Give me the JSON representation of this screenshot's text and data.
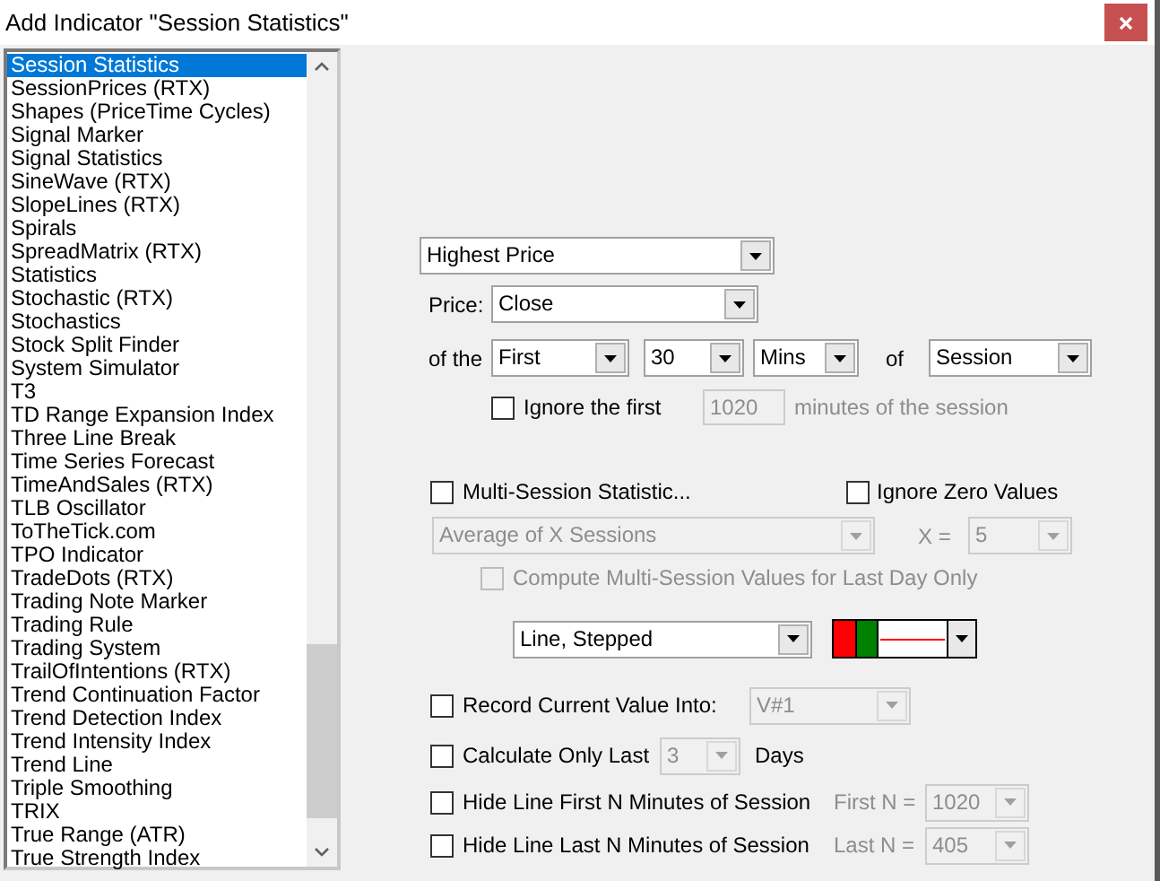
{
  "window": {
    "title": "Add Indicator \"Session Statistics\""
  },
  "indicator_list": {
    "items": [
      {
        "label": "Session Statistics",
        "selected": true
      },
      {
        "label": "SessionPrices (RTX)",
        "selected": false
      },
      {
        "label": "Shapes (PriceTime Cycles)",
        "selected": false
      },
      {
        "label": "Signal Marker",
        "selected": false
      },
      {
        "label": "Signal Statistics",
        "selected": false
      },
      {
        "label": "SineWave (RTX)",
        "selected": false
      },
      {
        "label": "SlopeLines (RTX)",
        "selected": false
      },
      {
        "label": "Spirals",
        "selected": false
      },
      {
        "label": "SpreadMatrix (RTX)",
        "selected": false
      },
      {
        "label": "Statistics",
        "selected": false
      },
      {
        "label": "Stochastic (RTX)",
        "selected": false
      },
      {
        "label": "Stochastics",
        "selected": false
      },
      {
        "label": "Stock Split Finder",
        "selected": false
      },
      {
        "label": "System Simulator",
        "selected": false
      },
      {
        "label": "T3",
        "selected": false
      },
      {
        "label": "TD Range Expansion Index",
        "selected": false
      },
      {
        "label": "Three Line Break",
        "selected": false
      },
      {
        "label": "Time Series Forecast",
        "selected": false
      },
      {
        "label": "TimeAndSales (RTX)",
        "selected": false
      },
      {
        "label": "TLB Oscillator",
        "selected": false
      },
      {
        "label": "ToTheTick.com",
        "selected": false
      },
      {
        "label": "TPO Indicator",
        "selected": false
      },
      {
        "label": "TradeDots (RTX)",
        "selected": false
      },
      {
        "label": "Trading Note Marker",
        "selected": false
      },
      {
        "label": "Trading Rule",
        "selected": false
      },
      {
        "label": "Trading System",
        "selected": false
      },
      {
        "label": "TrailOfIntentions (RTX)",
        "selected": false
      },
      {
        "label": "Trend Continuation Factor",
        "selected": false
      },
      {
        "label": "Trend Detection Index",
        "selected": false
      },
      {
        "label": "Trend Intensity Index",
        "selected": false
      },
      {
        "label": "Trend Line",
        "selected": false
      },
      {
        "label": "Triple Smoothing",
        "selected": false
      },
      {
        "label": "TRIX",
        "selected": false
      },
      {
        "label": "True Range (ATR)",
        "selected": false
      },
      {
        "label": "True Strength Index",
        "selected": false
      }
    ]
  },
  "statistic": {
    "value": "Highest Price",
    "disabled": false
  },
  "price": {
    "label": "Price:",
    "combo": {
      "value": "Close",
      "disabled": false
    }
  },
  "range": {
    "label": "of the",
    "position": {
      "value": "First",
      "disabled": false
    },
    "count": {
      "value": "30",
      "disabled": false
    },
    "unit": {
      "value": "Mins",
      "disabled": false
    },
    "of_label": "of",
    "period": {
      "value": "Session",
      "disabled": false
    }
  },
  "ignore_first": {
    "checked": false,
    "label": "Ignore the first",
    "value": "1020",
    "disabled": true,
    "suffix": "minutes of the session"
  },
  "multi_session": {
    "checked": false,
    "label": "Multi-Session Statistic...",
    "method": {
      "value": "Average of X Sessions",
      "disabled": true
    },
    "x_label": "X =",
    "x": {
      "value": "5",
      "disabled": true
    }
  },
  "ignore_zero": {
    "checked": false,
    "label": "Ignore Zero Values"
  },
  "last_day_only": {
    "checked": false,
    "disabled": true,
    "label": "Compute Multi-Session Values for Last Day Only"
  },
  "line_style": {
    "value": "Line, Stepped",
    "disabled": false
  },
  "line_colors": [
    {
      "kind": "swatch",
      "color": "#ff0000"
    },
    {
      "kind": "swatch",
      "color": "#008000"
    },
    {
      "kind": "line",
      "color": "#ff0000"
    }
  ],
  "options": [
    {
      "kind": "record",
      "checked": false,
      "label": "Record Current Value Into:",
      "combo": {
        "value": "V#1",
        "disabled": true
      }
    },
    {
      "kind": "days",
      "checked": false,
      "label": "Calculate Only Last",
      "combo": {
        "value": "3",
        "disabled": true
      },
      "suffix": "Days"
    },
    {
      "kind": "minutes",
      "checked": false,
      "label": "Hide Line First N Minutes of Session",
      "field_label": "First N =",
      "combo": {
        "value": "1020",
        "disabled": true
      }
    },
    {
      "kind": "minutes",
      "checked": false,
      "label": "Hide Line Last N Minutes of Session",
      "field_label": "Last N =",
      "combo": {
        "value": "405",
        "disabled": true
      }
    }
  ]
}
